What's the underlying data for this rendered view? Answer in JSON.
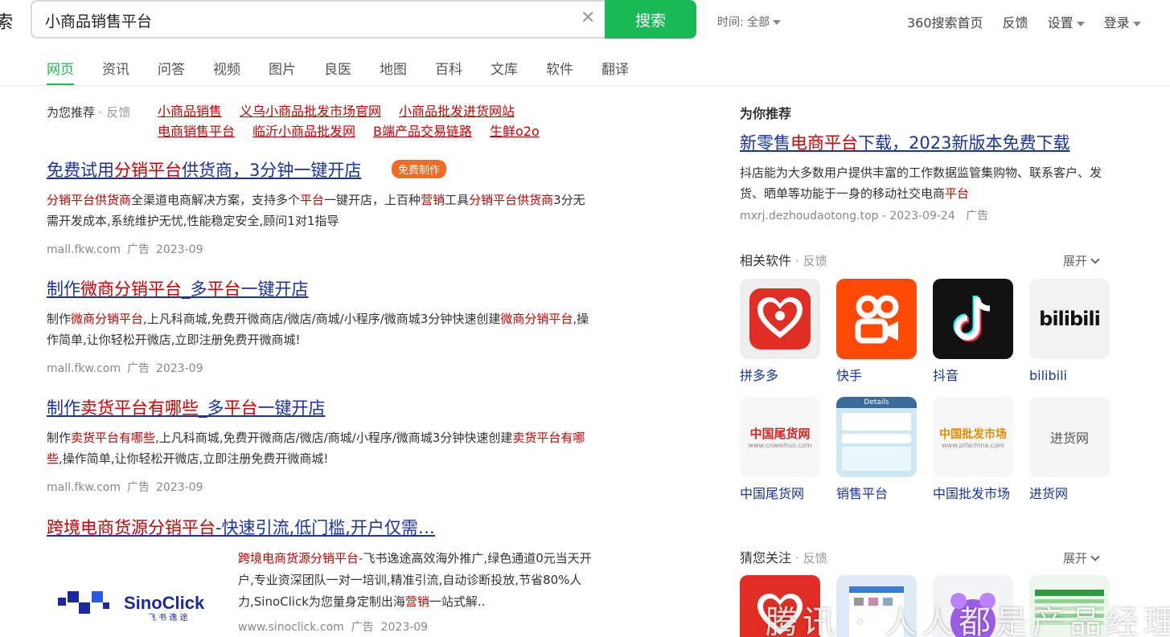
{
  "header": {
    "logo_fragment": "索",
    "search_value": "小商品销售平台",
    "search_button": "搜索",
    "time_filter": "时间: 全部",
    "top_links": [
      "360搜索首页",
      "反馈",
      "设置",
      "登录"
    ]
  },
  "tabs": [
    "网页",
    "资讯",
    "问答",
    "视频",
    "图片",
    "良医",
    "地图",
    "百科",
    "文库",
    "软件",
    "翻译"
  ],
  "recommend": {
    "label": "为您推荐",
    "feedback": "· 反馈",
    "links": [
      "小商品销售",
      "义乌小商品批发市场官网",
      "小商品批发进货网站",
      "电商销售平台",
      "临沂小商品批发网",
      "B端产品交易链路",
      "生鲜o2o"
    ]
  },
  "results": [
    {
      "title_parts": [
        [
          "免费试用",
          false
        ],
        [
          "分销平台",
          true
        ],
        [
          "供货商，3分钟一键开店",
          false
        ]
      ],
      "badge": "免费制作",
      "desc_parts": [
        [
          "分销平台供货商",
          true
        ],
        [
          "全渠道电商解决方案，支持多个",
          false
        ],
        [
          "平台",
          true
        ],
        [
          "一键开店，上百种",
          false
        ],
        [
          "营销",
          true
        ],
        [
          "工具",
          false
        ],
        [
          "分销平台供货商",
          true
        ],
        [
          "3分无需开发成本,系统维护无忧,性能稳定安全,顾问1对1指导",
          false
        ]
      ],
      "url": "mall.fkw.com",
      "ad": "广告",
      "date": "2023-09"
    },
    {
      "title_parts": [
        [
          "制作",
          false
        ],
        [
          "微商分销平台",
          true
        ],
        [
          "_多",
          false
        ],
        [
          "平台",
          true
        ],
        [
          "一键开店",
          false
        ]
      ],
      "badge": "",
      "desc_parts": [
        [
          "制作",
          false
        ],
        [
          "微商分销平台",
          true
        ],
        [
          ",上凡科商城,免费开微商店/微店/商城/小程序/微商城3分钟快速创建",
          false
        ],
        [
          "微商分销平台",
          true
        ],
        [
          ",操作简单,让你轻松开微店,立即注册免费开微商城!",
          false
        ]
      ],
      "url": "mall.fkw.com",
      "ad": "广告",
      "date": "2023-09"
    },
    {
      "title_parts": [
        [
          "制作",
          false
        ],
        [
          "卖货平台有哪些",
          true
        ],
        [
          "_多",
          false
        ],
        [
          "平台",
          true
        ],
        [
          "一键开店",
          false
        ]
      ],
      "badge": "",
      "desc_parts": [
        [
          "制作",
          false
        ],
        [
          "卖货平台有哪些",
          true
        ],
        [
          ",上凡科商城,免费开微商店/微店/商城/小程序/微商城3分钟快速创建",
          false
        ],
        [
          "卖货平台有哪些",
          true
        ],
        [
          ",操作简单,让你轻松开微店,立即注册免费开微商城!",
          false
        ]
      ],
      "url": "mall.fkw.com",
      "ad": "广告",
      "date": "2023-09"
    }
  ],
  "sino": {
    "title_parts": [
      [
        "跨境电商货源分销平台",
        true
      ],
      [
        "-快速引流,低门槛,开户仅需…",
        false
      ]
    ],
    "desc_parts": [
      [
        "跨境电商货源分销平台",
        true
      ],
      [
        "-飞书逸途高效海外推广,绿色通道0元当天开户,专业资深团队一对一培训,精准引流,自动诊断投放,节省80%人力,SinoClick为您量身定制出海",
        false
      ],
      [
        "营销",
        true
      ],
      [
        "一站式解..",
        false
      ]
    ],
    "logo_text": "SinoClick",
    "logo_sub": "飞 书 逸 途",
    "url": "www.sinoclick.com",
    "ad": "广告",
    "date": "2023-09"
  },
  "side": {
    "rec_heading": "为你推荐",
    "ad_title_parts": [
      [
        "新零售",
        false
      ],
      [
        "电商平台",
        true
      ],
      [
        "下载，2023新版本免费下载",
        false
      ]
    ],
    "ad_desc_parts": [
      [
        "抖店能为大多数用户提供丰富的工作数据监管集购物、联系客户、发货、晒单等功能于一身的移动社交电商",
        false
      ],
      [
        "平台",
        true
      ]
    ],
    "ad_url": "mxrj.dezhoudaotong.top - 2023-09-24",
    "ad_label": "广告",
    "software_heading": "相关软件",
    "software_feedback": "· 反馈",
    "expand": "展开",
    "apps_row1": [
      "拼多多",
      "快手",
      "抖音",
      "bilibili"
    ],
    "apps_row2": [
      "中国尾货网",
      "销售平台",
      "中国批发市场",
      "进货网"
    ],
    "icon_texts": {
      "bilibili": "bilibili",
      "weihuo": "中国尾货网",
      "weihuo_url": "www.cnweihuo.com",
      "pifa": "中国批发市场",
      "pifa_url": "www.pifachina.com",
      "jinhuo": "进货网",
      "details": "Details"
    },
    "guess_heading": "猜您关注",
    "guess_feedback": "· 反馈"
  },
  "watermark": "腾讯 · 人人都是产品经理"
}
